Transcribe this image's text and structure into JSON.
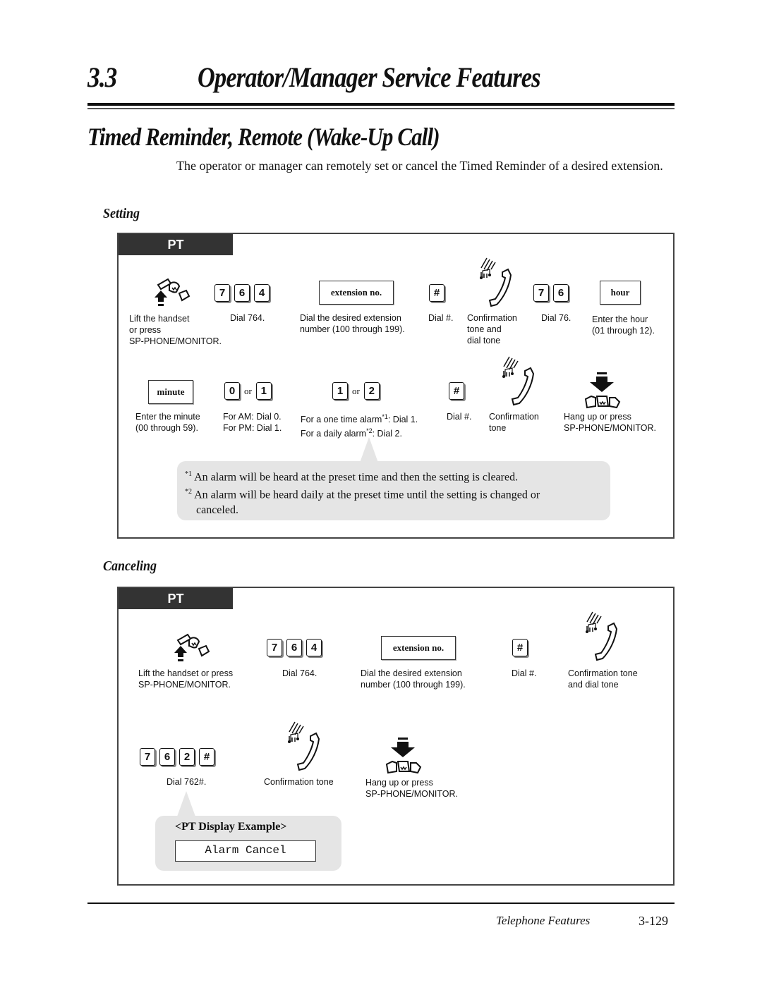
{
  "header": {
    "section_number": "3.3",
    "section_title": "Operator/Manager Service Features"
  },
  "page_title": "Timed Reminder, Remote (Wake-Up Call)",
  "intro": "The operator or manager can remotely set or cancel the Timed Reminder of a desired extension.",
  "setting": {
    "heading": "Setting",
    "tab_label": "PT",
    "row1": {
      "lift_caption": [
        "Lift the handset",
        "or press",
        "SP-PHONE/MONITOR."
      ],
      "keys_764": [
        "7",
        "6",
        "4"
      ],
      "dial_764_caption": "Dial 764.",
      "extension_box": "extension no.",
      "extension_caption": [
        "Dial the desired extension",
        "number (100 through 199)."
      ],
      "hash_key": "#",
      "hash_caption": "Dial #.",
      "confirm_caption": [
        "Confirmation",
        "tone and",
        "dial tone"
      ],
      "keys_76": [
        "7",
        "6"
      ],
      "dial_76_caption": "Dial 76.",
      "hour_box": "hour",
      "hour_caption": [
        "Enter the hour",
        "(01 through 12)."
      ]
    },
    "row2": {
      "minute_box": "minute",
      "minute_caption": [
        "Enter the minute",
        "(00 through 59)."
      ],
      "ampm_keys": [
        "0",
        "1"
      ],
      "or_label": "or",
      "ampm_caption": [
        "For AM: Dial 0.",
        "For PM: Dial 1."
      ],
      "alarm_keys": [
        "1",
        "2"
      ],
      "alarm_caption_1": "For a one time alarm",
      "alarm_caption_1_sup": "*1",
      "alarm_caption_1_tail": ": Dial 1.",
      "alarm_caption_2": "For a daily alarm",
      "alarm_caption_2_sup": "*2",
      "alarm_caption_2_tail": ": Dial 2.",
      "hash_key": "#",
      "hash_caption": "Dial #.",
      "confirm_caption": [
        "Confirmation",
        "tone"
      ],
      "hangup_caption": [
        "Hang up or press",
        "SP-PHONE/MONITOR."
      ]
    },
    "footnotes": [
      {
        "mark": "*1",
        "text": "An alarm will be heard at the preset time and then the setting is cleared."
      },
      {
        "mark": "*2",
        "text": "An alarm will be heard daily at the preset time until the setting is changed or",
        "cont": "canceled."
      }
    ]
  },
  "canceling": {
    "heading": "Canceling",
    "tab_label": "PT",
    "row1": {
      "lift_caption": [
        "Lift the handset or press",
        "SP-PHONE/MONITOR."
      ],
      "keys_764": [
        "7",
        "6",
        "4"
      ],
      "dial_764_caption": "Dial 764.",
      "extension_box": "extension no.",
      "extension_caption": [
        "Dial the desired extension",
        "number (100 through 199)."
      ],
      "hash_key": "#",
      "hash_caption": "Dial #.",
      "confirm_caption": [
        "Confirmation tone",
        "and dial tone"
      ]
    },
    "row2": {
      "keys_762h": [
        "7",
        "6",
        "2",
        "#"
      ],
      "dial_762_caption": "Dial 762#.",
      "confirm_caption": "Confirmation tone",
      "hangup_caption": [
        "Hang up or press",
        "SP-PHONE/MONITOR."
      ]
    },
    "display_example": {
      "label": "<PT Display Example>",
      "text": "Alarm Cancel"
    }
  },
  "footer": {
    "chapter": "Telephone Features",
    "page_number": "3-129"
  }
}
